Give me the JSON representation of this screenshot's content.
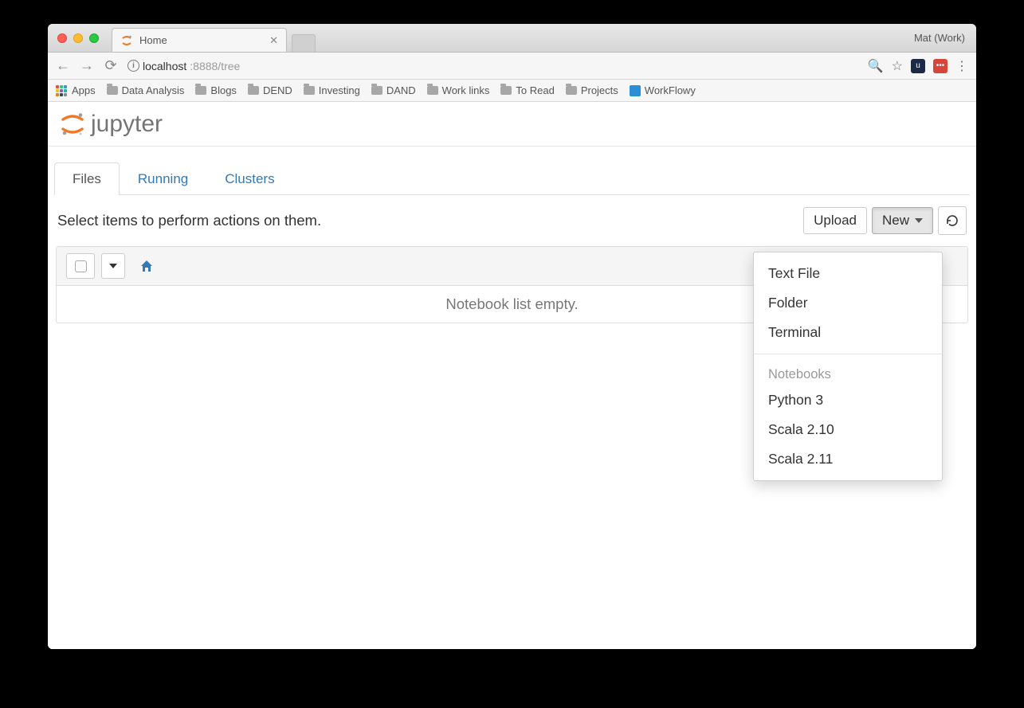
{
  "browser": {
    "profile_label": "Mat (Work)",
    "tab_title": "Home",
    "url_host": "localhost",
    "url_port_path": ":8888/tree",
    "apps_label": "Apps",
    "bookmarks": [
      "Data Analysis",
      "Blogs",
      "DEND",
      "Investing",
      "DAND",
      "Work links",
      "To Read",
      "Projects"
    ],
    "workflowy_label": "WorkFlowy"
  },
  "jupyter": {
    "logo_text": "jupyter",
    "tabs": {
      "files": "Files",
      "running": "Running",
      "clusters": "Clusters"
    },
    "action_text": "Select items to perform actions on them.",
    "upload_label": "Upload",
    "new_label": "New",
    "empty_text": "Notebook list empty."
  },
  "new_menu": {
    "text_file": "Text File",
    "folder": "Folder",
    "terminal": "Terminal",
    "notebooks_header": "Notebooks",
    "kernels": [
      "Python 3",
      "Scala 2.10",
      "Scala 2.11"
    ]
  }
}
